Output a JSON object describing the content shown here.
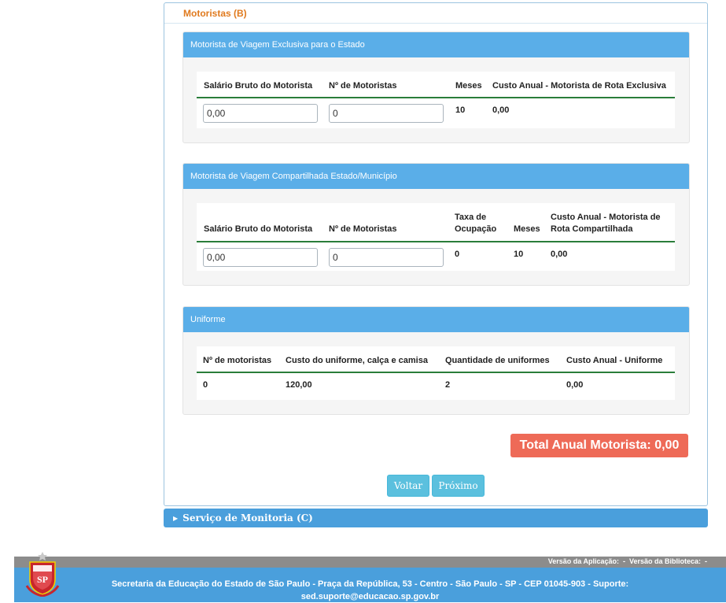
{
  "section": {
    "title": "Motoristas (B)"
  },
  "exclusive": {
    "title": "Motorista de Viagem Exclusiva para o Estado",
    "headers": {
      "salario": "Salário Bruto do Motorista",
      "num": "Nº de Motoristas",
      "meses": "Meses",
      "custo": "Custo Anual - Motorista de Rota Exclusiva"
    },
    "row": {
      "salario": "0,00",
      "num": "0",
      "meses": "10",
      "custo": "0,00"
    }
  },
  "shared": {
    "title": "Motorista de Viagem Compartilhada Estado/Município",
    "headers": {
      "salario": "Salário Bruto do Motorista",
      "num": "Nº de Motoristas",
      "taxa_l1": "Taxa de",
      "taxa_l2": "Ocupação",
      "meses": "Meses",
      "custo_l1": "Custo Anual - Motorista de",
      "custo_l2": "Rota Compartilhada"
    },
    "row": {
      "salario": "0,00",
      "num": "0",
      "taxa": "0",
      "meses": "10",
      "custo": "0,00"
    }
  },
  "uniform": {
    "title": "Uniforme",
    "headers": {
      "num": "Nº de motoristas",
      "custo_uniforme": "Custo do uniforme, calça e camisa",
      "qtd": "Quantidade de uniformes",
      "custo_anual": "Custo Anual - Uniforme"
    },
    "row": {
      "num": "0",
      "custo_uniforme": "120,00",
      "qtd": "2",
      "custo_anual": "0,00"
    }
  },
  "total": {
    "label": "Total Anual Motorista: 0,00"
  },
  "buttons": {
    "back": "Voltar",
    "next": "Próximo"
  },
  "next_section": {
    "title": "Serviço de Monitoria (C)"
  },
  "footer": {
    "version": "Versão da Aplicação:  -  Versão da Biblioteca:  -",
    "address_l1": "Secretaria da Educação do Estado de São Paulo - Praça da República, 53 - Centro - São Paulo - SP - CEP 01045-903 - Suporte:",
    "address_l2": "sed.suporte@educacao.sp.gov.br"
  },
  "colors": {
    "accent": "#5aaee8",
    "section_title": "#e07a1e",
    "total_badge": "#ee6a57",
    "rule": "#2a7d3a",
    "button": "#5bc0de"
  },
  "icons": {
    "collapsed_caret": "caret-right-icon",
    "seal": "sp-state-seal-icon"
  }
}
